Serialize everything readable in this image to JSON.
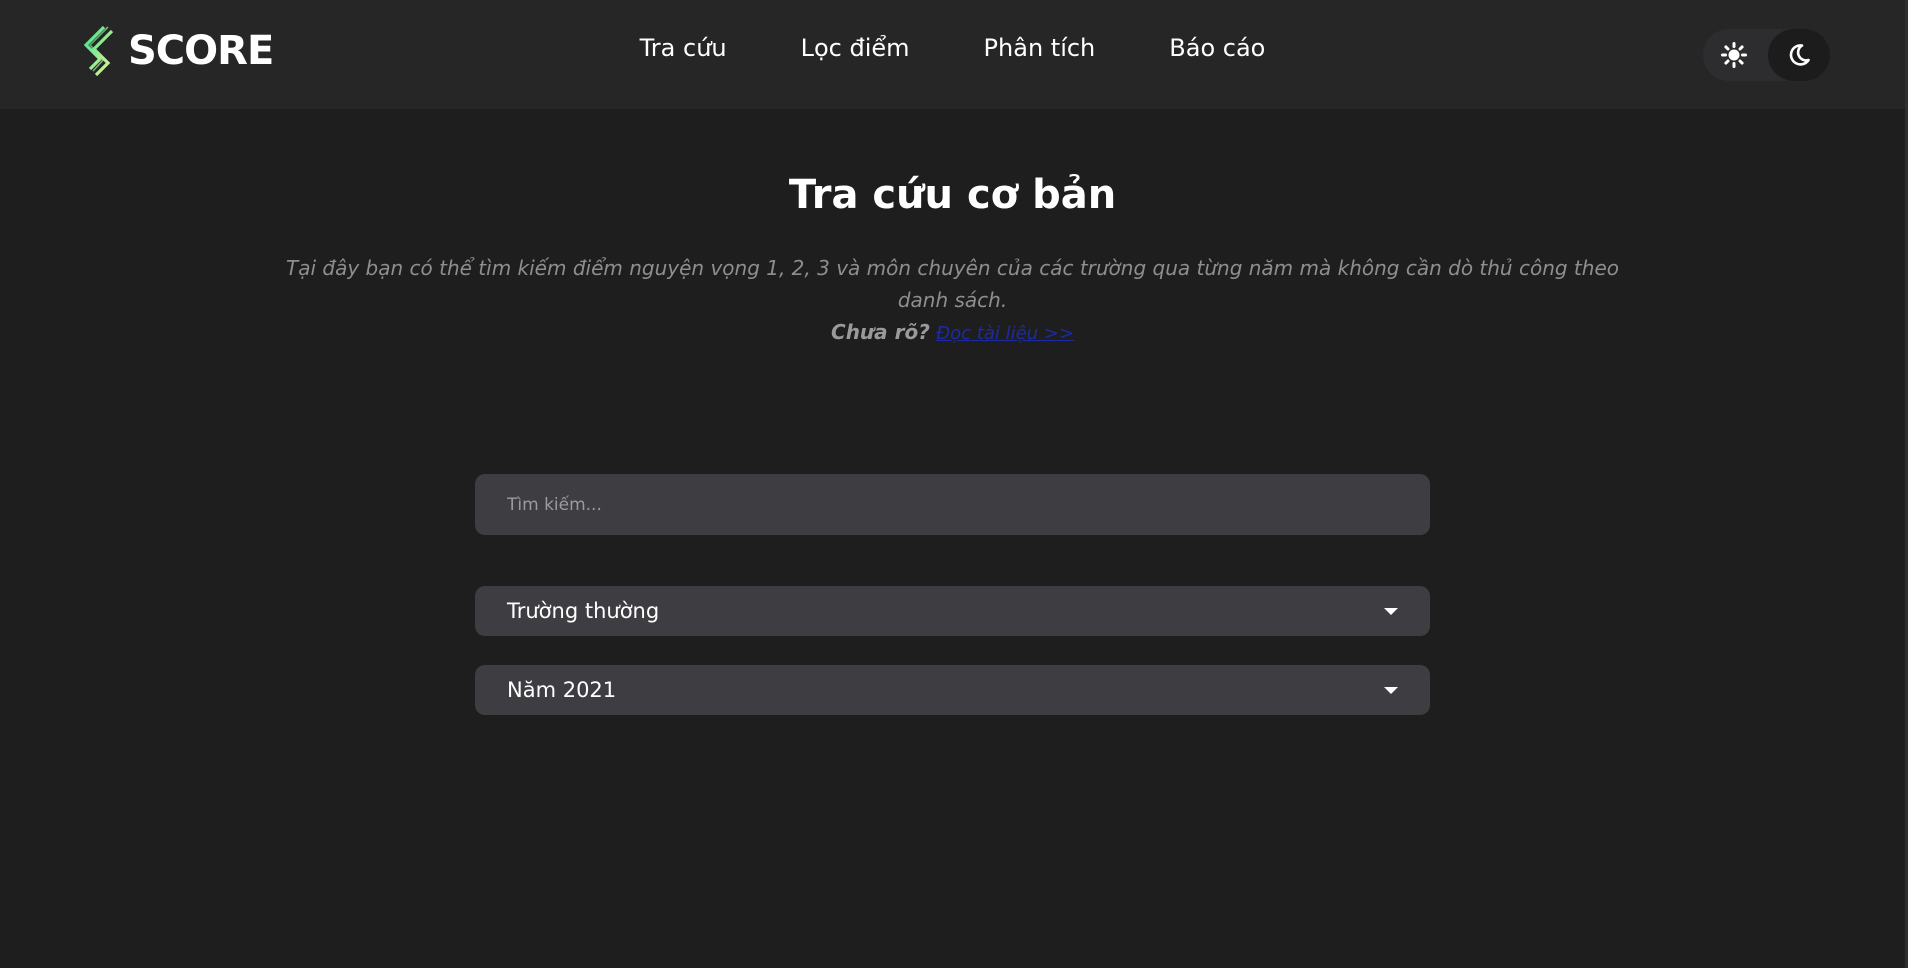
{
  "brand": {
    "logo_text": "SCORE",
    "logo_colors": {
      "green": "#3ee28c",
      "yellow": "#e8f59a"
    }
  },
  "nav": {
    "items": [
      {
        "label": "Tra cứu"
      },
      {
        "label": "Lọc điểm"
      },
      {
        "label": "Phân tích"
      },
      {
        "label": "Báo cáo"
      }
    ]
  },
  "theme_toggle": {
    "options": [
      {
        "icon": "sun-icon",
        "mode": "light"
      },
      {
        "icon": "moon-icon",
        "mode": "dark"
      }
    ],
    "active": "dark"
  },
  "main": {
    "title": "Tra cứu cơ bản",
    "description": "Tại đây bạn có thể tìm kiếm điểm nguyện vọng 1, 2, 3 và môn chuyên của các trường qua từng năm mà không cần dò thủ công theo danh sách.",
    "help_prefix": "Chưa rõ?",
    "help_link": "Đọc tài liệu >>",
    "search": {
      "placeholder": "Tìm kiếm...",
      "value": ""
    },
    "school_type_select": {
      "value": "Trường thường"
    },
    "year_select": {
      "value": "Năm 2021"
    }
  },
  "colors": {
    "background": "#1e1e1f",
    "header": "#262627",
    "input": "#3e3e42",
    "link": "#1d2ba3"
  }
}
